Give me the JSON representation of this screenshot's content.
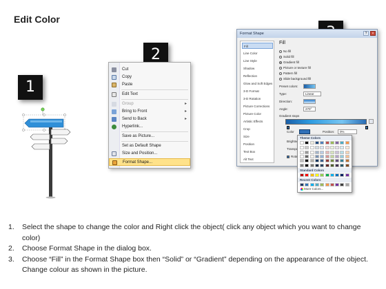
{
  "page": {
    "title": "Edit Color"
  },
  "badges": [
    "1",
    "2",
    "3"
  ],
  "context_menu": {
    "items": [
      {
        "label": "Cut",
        "icon": "scissors-icon",
        "enabled": true
      },
      {
        "label": "Copy",
        "icon": "copy-icon",
        "enabled": true
      },
      {
        "label": "Paste",
        "icon": "paste-icon",
        "enabled": true
      },
      {
        "label": "Edit Text",
        "icon": "edit-text-icon",
        "enabled": true
      },
      {
        "label": "Group",
        "icon": "group-icon",
        "enabled": false,
        "submenu": true
      },
      {
        "label": "Bring to Front",
        "icon": "bring-front-icon",
        "enabled": true,
        "submenu": true
      },
      {
        "label": "Send to Back",
        "icon": "send-back-icon",
        "enabled": true,
        "submenu": true
      },
      {
        "label": "Hyperlink...",
        "icon": "hyperlink-icon",
        "enabled": true
      },
      {
        "label": "Save as Picture...",
        "icon": "",
        "enabled": true
      },
      {
        "label": "Set as Default Shape",
        "icon": "",
        "enabled": true
      },
      {
        "label": "Size and Position...",
        "icon": "size-icon",
        "enabled": true
      },
      {
        "label": "Format Shape...",
        "icon": "format-shape-icon",
        "enabled": true,
        "highlighted": true
      }
    ]
  },
  "dialog": {
    "title": "Format Shape",
    "sidebar": [
      "Fill",
      "Line Color",
      "Line Style",
      "Shadow",
      "Reflection",
      "Glow and Soft Edges",
      "3-D Format",
      "3-D Rotation",
      "Picture Corrections",
      "Picture Color",
      "Artistic Effects",
      "Crop",
      "Size",
      "Position",
      "Text Box",
      "Alt Text"
    ],
    "selected_sidebar": "Fill",
    "pane": {
      "heading": "Fill",
      "options": [
        "No fill",
        "Solid fill",
        "Gradient fill",
        "Picture or texture fill",
        "Pattern fill",
        "Slide background fill"
      ],
      "selected_option": "Gradient fill",
      "preset_label": "Preset colors:",
      "type_label": "Type:",
      "type_value": "Linear",
      "direction_label": "Direction:",
      "angle_label": "Angle:",
      "angle_value": "270°",
      "stops_label": "Gradient stops",
      "color_label": "Color",
      "position_label": "Position:",
      "position_value": "0%",
      "brightness_label": "Brightne",
      "transparency_label": "Transpare",
      "rotate_label": "Rotate"
    },
    "palette": {
      "theme_header": "Theme Colors",
      "standard_header": "Standard Colors",
      "recent_header": "Recent Colors",
      "more_label": "More Colors...",
      "theme_top": [
        "#ffffff",
        "#000000",
        "#eeece1",
        "#1f497d",
        "#4f81bd",
        "#c0504d",
        "#9bbb59",
        "#8064a2",
        "#4bacc6",
        "#f79646"
      ],
      "standard": [
        "#c00000",
        "#ff0000",
        "#ffc000",
        "#ffff00",
        "#92d050",
        "#00b050",
        "#00b0f0",
        "#0070c0",
        "#002060",
        "#7030a0"
      ],
      "recent": [
        "#1f3864",
        "#2e75b6",
        "#00b0f0",
        "#4bacc6",
        "#9bbb59",
        "#f79646",
        "#c0504d",
        "#7030a0",
        "#404040",
        "#a6a6a6"
      ]
    }
  },
  "steps": [
    {
      "num": "1.",
      "text": "Select the shape to change the color and Right click the object( click any object which you want to change color)"
    },
    {
      "num": "2.",
      "text": "Choose Format Shape in the dialog box."
    },
    {
      "num": "3.",
      "text": "Choose “Fill” in the Format Shape box then “Solid” or “Gradient” depending on the appearance of the object. Change colour as shown in the picture."
    }
  ],
  "colors": {
    "badge_bg": "#111111",
    "sign_blue": "#2f8fd8",
    "menu_highlight": "#ffe28a",
    "dialog_title_bg": "#c3d4ea"
  }
}
